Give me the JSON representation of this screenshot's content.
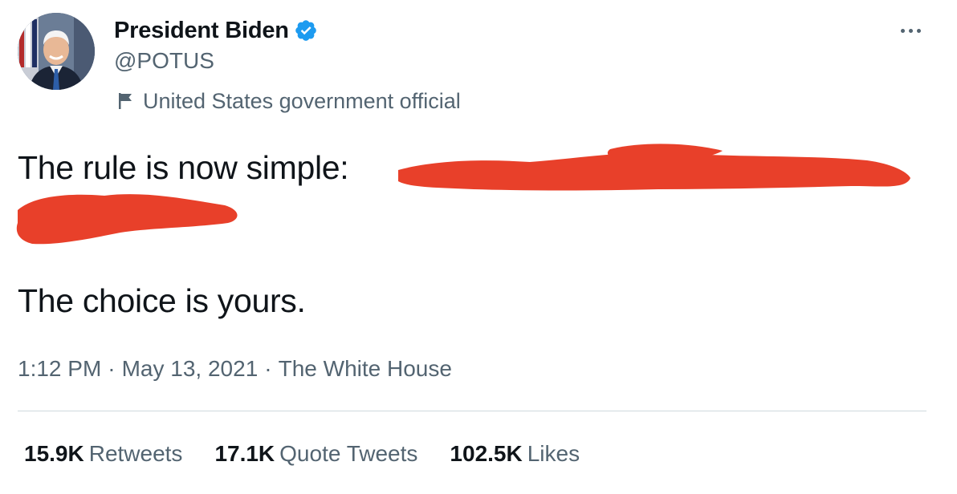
{
  "author": {
    "display_name": "President Biden",
    "handle": "@POTUS",
    "verified": true,
    "label": "United States government official",
    "avatar_icon": "portrait-photo"
  },
  "more_icon": "ellipsis-icon",
  "tweet": {
    "line1_visible": "The rule is now simple:",
    "line2_visible": "",
    "line3": "The choice is yours.",
    "redacted": true,
    "redaction_color": "#e8402a"
  },
  "meta": {
    "time": "1:12 PM",
    "date": "May 13, 2021",
    "source": "The White House",
    "separator": "·"
  },
  "stats": [
    {
      "count": "15.9K",
      "label": "Retweets"
    },
    {
      "count": "17.1K",
      "label": "Quote Tweets"
    },
    {
      "count": "102.5K",
      "label": "Likes"
    }
  ],
  "colors": {
    "primary_text": "#0f1419",
    "secondary_text": "#536471",
    "verified_blue": "#1d9bf0",
    "divider": "#cfd9de"
  }
}
